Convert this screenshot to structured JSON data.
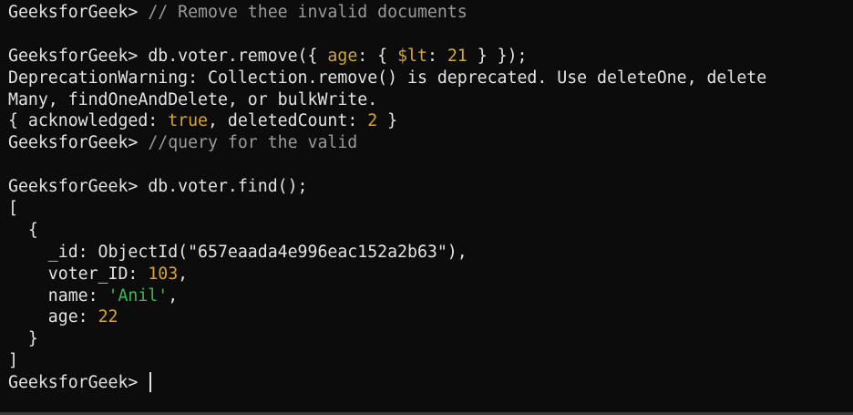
{
  "prompt": "GeeksforGeek>",
  "lines": {
    "l1_comment": "// Remove thee invalid documents",
    "l3_cmd_a": "db.voter.remove({ ",
    "l3_key": "age",
    "l3_cmd_b": ": { ",
    "l3_op": "$lt",
    "l3_cmd_c": ": ",
    "l3_num": "21",
    "l3_cmd_d": " } });",
    "l4_warn": "DeprecationWarning: Collection.remove() is deprecated. Use deleteOne, delete",
    "l5_warn": "Many, findOneAndDelete, or bulkWrite.",
    "l6_a": "{ acknowledged: ",
    "l6_true": "true",
    "l6_b": ", deletedCount: ",
    "l6_num": "2",
    "l6_c": " }",
    "l7_comment": "//query for the valid",
    "l9_cmd": "db.voter.find();",
    "l10": "[",
    "l11": "  {",
    "l12_a": "    _id: ObjectId(\"657eaada4e996eac152a2b63\"),",
    "l13_a": "    voter_ID: ",
    "l13_num": "103",
    "l13_b": ",",
    "l14_a": "    name: ",
    "l14_str": "'Anil'",
    "l14_b": ",",
    "l15_a": "    age: ",
    "l15_num": "22",
    "l16": "  }",
    "l17": "]"
  },
  "colors": {
    "background": "#0c0c0c",
    "foreground": "#e3e3e3",
    "comment": "#9a9a9a",
    "number": "#d4a436",
    "string": "#3fb950"
  }
}
